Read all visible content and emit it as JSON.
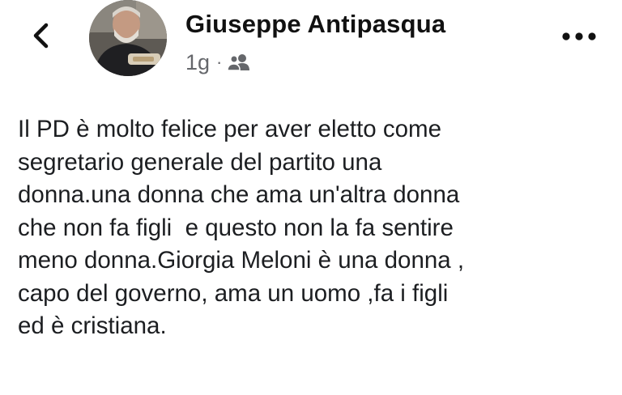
{
  "header": {
    "back_icon": "chevron-left-icon",
    "author_name": "Giuseppe Antipasqua",
    "timestamp": "1g",
    "separator": "·",
    "audience_icon": "friends-icon",
    "more_icon": "more-horizontal-icon"
  },
  "post": {
    "lines": [
      "Il PD è molto felice per aver eletto come",
      "segretario generale del partito una",
      "donna.una donna che ama un'altra donna",
      "che non fa figli  e questo non la fa sentire",
      "meno donna.Giorgia Meloni è una donna ,",
      "capo del governo, ama un uomo ,fa i figli",
      "ed è cristiana."
    ]
  },
  "colors": {
    "text": "#1c1e21",
    "secondary_text": "#65676b",
    "background": "#ffffff"
  }
}
